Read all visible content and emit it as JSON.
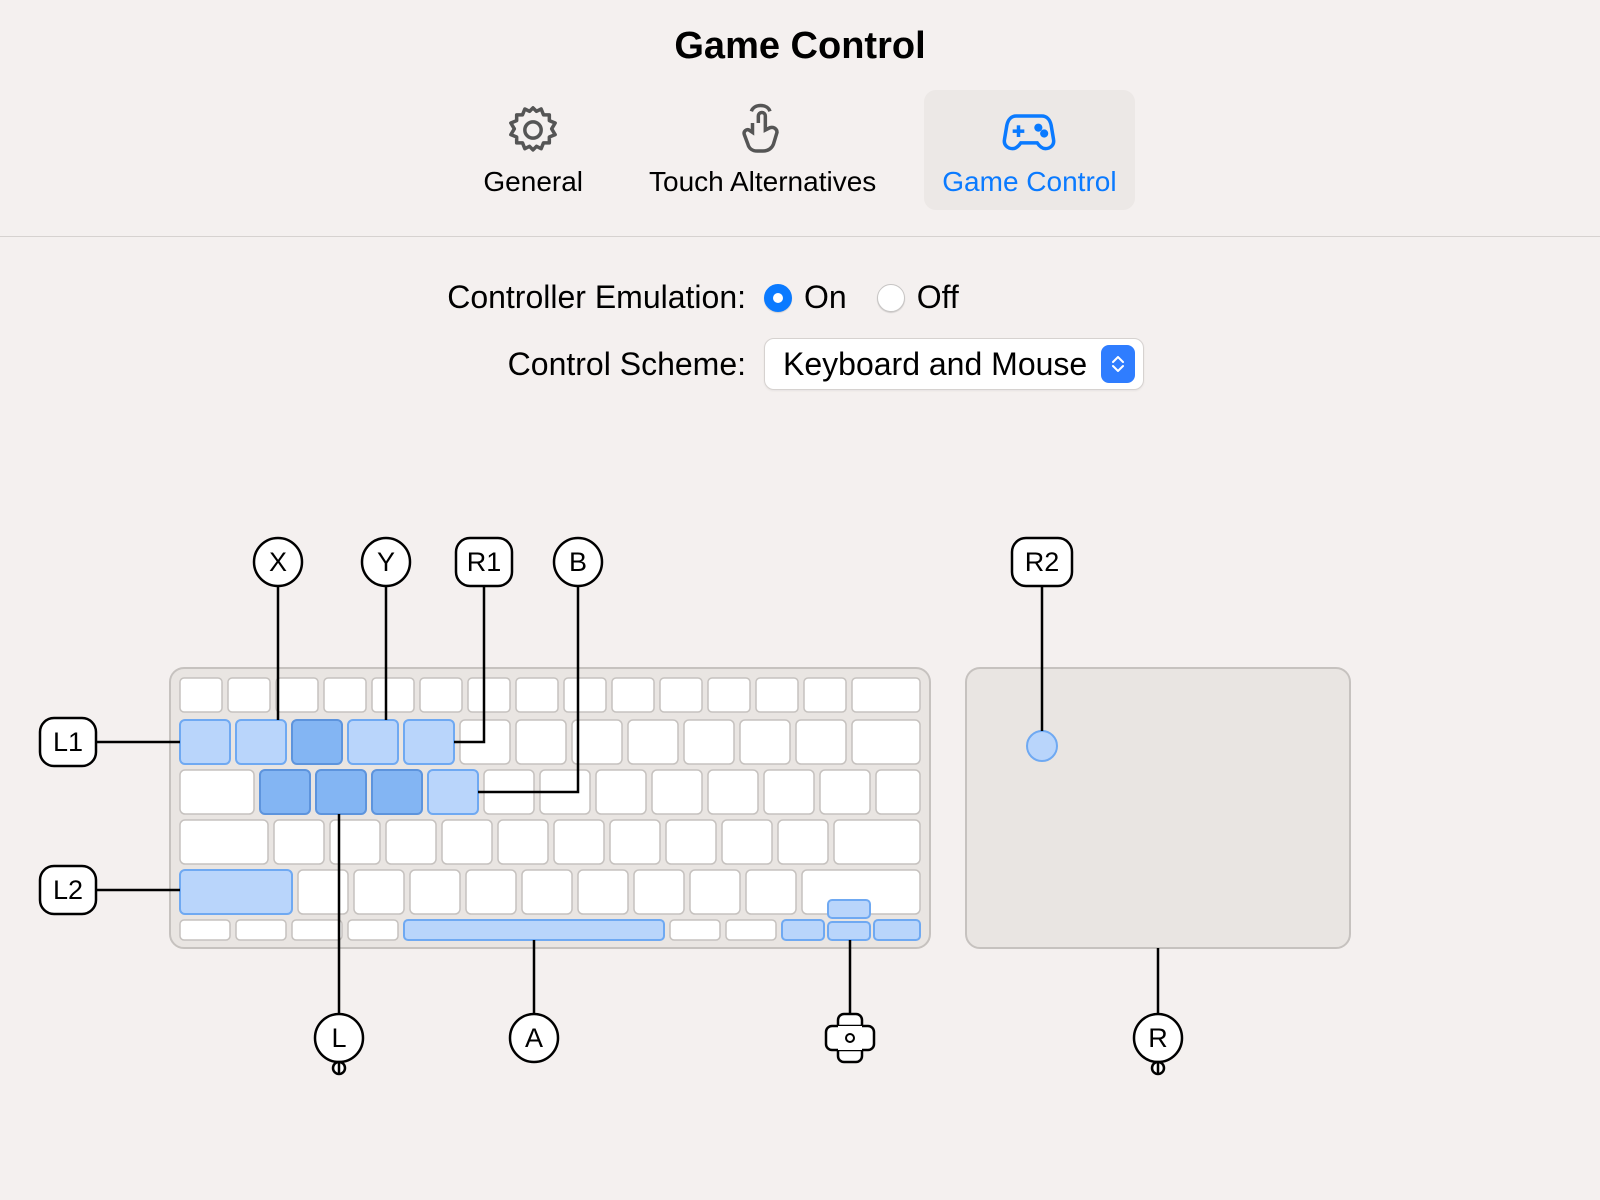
{
  "header": {
    "title": "Game Control"
  },
  "tabs": {
    "general": "General",
    "touch": "Touch Alternatives",
    "game": "Game Control"
  },
  "form": {
    "emulation_label": "Controller Emulation:",
    "emulation_on": "On",
    "emulation_off": "Off",
    "scheme_label": "Control Scheme:",
    "scheme_value": "Keyboard and Mouse"
  },
  "annotations": {
    "X": "X",
    "Y": "Y",
    "R1": "R1",
    "B": "B",
    "R2": "R2",
    "L1": "L1",
    "L2": "L2",
    "L": "L",
    "A": "A",
    "R": "R"
  }
}
